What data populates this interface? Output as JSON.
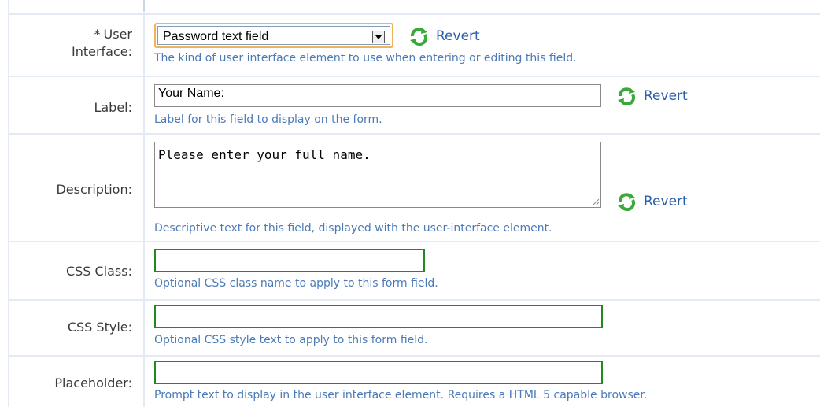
{
  "rows": {
    "user_interface": {
      "required_mark": "*",
      "label_line1": "User",
      "label_line2": "Interface:",
      "select_value": "Password text field",
      "revert": "Revert",
      "hint": "The kind of user interface element to use when entering or editing this field."
    },
    "label": {
      "label": "Label:",
      "value": "Your Name:",
      "revert": "Revert",
      "hint": "Label for this field to display on the form."
    },
    "description": {
      "label": "Description:",
      "value": "Please enter your full name.",
      "revert": "Revert",
      "hint": "Descriptive text for this field, displayed with the user-interface element."
    },
    "css_class": {
      "label": "CSS Class:",
      "value": "",
      "hint": "Optional CSS class name to apply to this form field."
    },
    "css_style": {
      "label": "CSS Style:",
      "value": "",
      "hint": "Optional CSS style text to apply to this form field."
    },
    "placeholder": {
      "label": "Placeholder:",
      "value": "",
      "hint": "Prompt text to display in the user interface element. Requires a HTML 5 capable browser."
    }
  },
  "icons": {
    "revert": "revert-icon"
  },
  "colors": {
    "hint": "#4a7ab8",
    "revert_link": "#2a5fa8",
    "focus_border": "#f0b35a",
    "green_border": "#1f8a1f",
    "grid_line": "#e3eaf4"
  }
}
